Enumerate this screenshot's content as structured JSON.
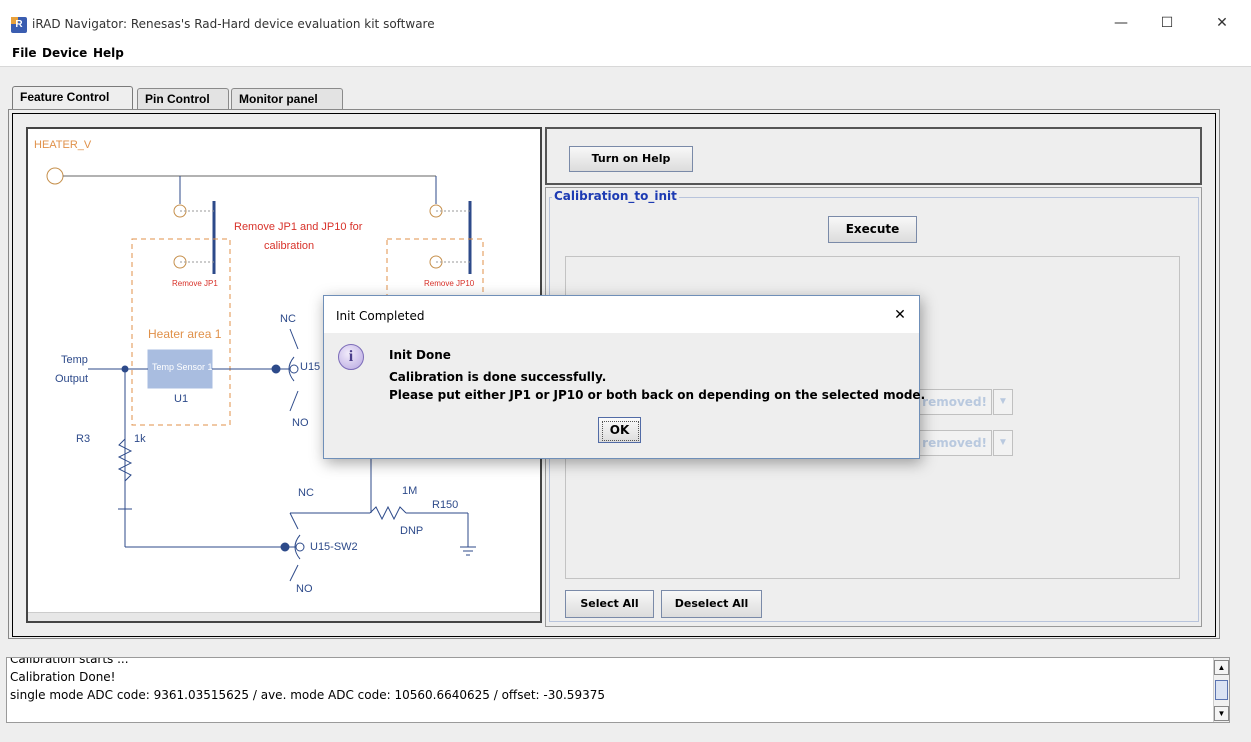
{
  "window": {
    "title": "iRAD Navigator: Renesas's Rad-Hard device evaluation kit software",
    "icon_letter": "R",
    "minimize": "—",
    "maximize": "☐",
    "close": "✕"
  },
  "menu": {
    "file": "File",
    "device": "Device",
    "help": "Help"
  },
  "tabs": [
    "Feature Control",
    "Pin Control",
    "Monitor panel"
  ],
  "diagram": {
    "heater_v": "HEATER_V",
    "remove_note_1": "Remove JP1 and JP10 for",
    "remove_note_2": "calibration",
    "remove_jp1": "Remove JP1",
    "remove_jp10": "Remove JP10",
    "nc_top": "NC",
    "heater_area": "Heater area 1",
    "temp_output_1": "Temp",
    "temp_output_2": "Output",
    "temp_sensor": "Temp Sensor 1",
    "u1": "U1",
    "u15_top": "U15",
    "no_top": "NO",
    "r3": "R3",
    "r3_val": "1k",
    "nc_bottom": "NC",
    "r150_val": "1M",
    "r150": "R150",
    "dnp": "DNP",
    "u15_sw2": "U15-SW2",
    "no_bottom": "NO"
  },
  "right_panel": {
    "help_button": "Turn on Help",
    "section_title": "Calibration_to_init",
    "execute_button": "Execute",
    "combo_1": "removed!",
    "combo_2": "removed!",
    "select_all": "Select All",
    "deselect_all": "Deselect All"
  },
  "dialog": {
    "title": "Init Completed",
    "close": "✕",
    "heading": "Init Done",
    "line1": "Calibration is done successfully.",
    "line2": "Please put either JP1 or JP10 or both back on depending on the selected mode.",
    "ok": "OK"
  },
  "log": {
    "lines": [
      "Calibration starts ...",
      "Calibration Done!",
      "single mode ADC code: 9361.03515625 / ave. mode ADC code: 10560.6640625 / offset: -30.59375"
    ]
  }
}
